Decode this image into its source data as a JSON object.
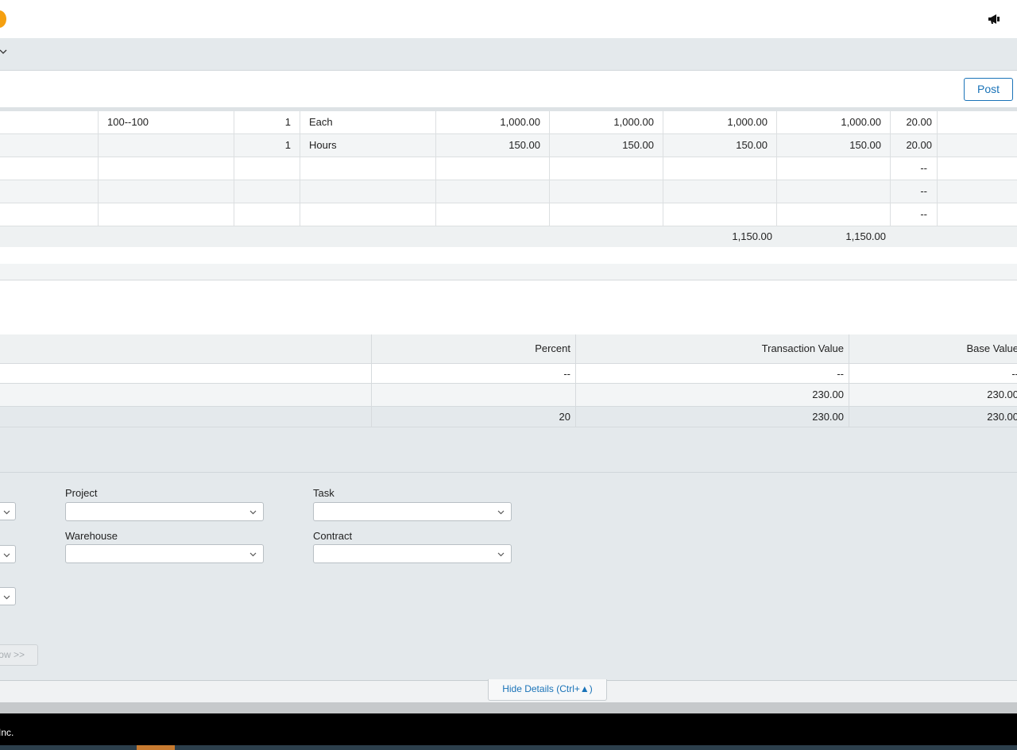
{
  "header": {
    "post_label": "Post"
  },
  "lines": {
    "rows": [
      [
        "100--100",
        "1",
        "Each",
        "1,000.00",
        "1,000.00",
        "1,000.00",
        "1,000.00",
        "20.00"
      ],
      [
        "",
        "1",
        "Hours",
        "150.00",
        "150.00",
        "150.00",
        "150.00",
        "20.00"
      ],
      [
        "",
        "",
        "",
        "",
        "",
        "",
        "",
        "--"
      ],
      [
        "",
        "",
        "",
        "",
        "",
        "",
        "",
        "--"
      ],
      [
        "",
        "",
        "",
        "",
        "",
        "",
        "",
        "--"
      ]
    ],
    "totals": [
      "1,150.00",
      "1,150.00"
    ]
  },
  "taxes": {
    "headers": [
      "Percent",
      "Transaction Value",
      "Base Value"
    ],
    "rows": [
      [
        "--",
        "--",
        "--"
      ],
      [
        "",
        "230.00",
        "230.00"
      ],
      [
        "20",
        "230.00",
        "230.00"
      ]
    ]
  },
  "fields": {
    "project_label": "Project",
    "task_label": "Task",
    "warehouse_label": "Warehouse",
    "contract_label": "Contract"
  },
  "buttons": {
    "show_label": "Show >>",
    "hide_details_label": "Hide Details (Ctrl+▲)"
  },
  "footer": {
    "text": "Inc."
  }
}
